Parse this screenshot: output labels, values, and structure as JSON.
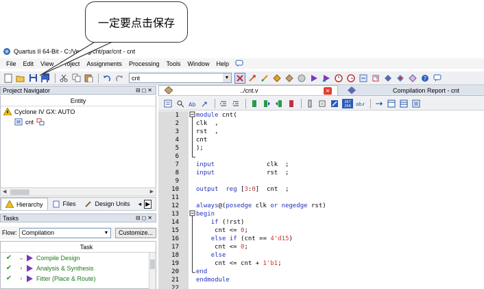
{
  "callout": {
    "text": "一定要点击保存"
  },
  "window": {
    "title": "Quartus II 64-Bit - C:/Verilog/cnt/par/cnt - cnt"
  },
  "menu": [
    "File",
    "Edit",
    "View",
    "Project",
    "Assignments",
    "Processing",
    "Tools",
    "Window",
    "Help"
  ],
  "toolbar": {
    "entity_combo": "cnt"
  },
  "project_navigator": {
    "title": "Project Navigator",
    "column": "Entity",
    "device": "Cyclone IV GX: AUTO",
    "top_entity": "cnt",
    "tabs": [
      "Hierarchy",
      "Files",
      "Design Units"
    ]
  },
  "tasks": {
    "title": "Tasks",
    "flow_label": "Flow:",
    "flow_value": "Compilation",
    "customize_label": "Customize...",
    "column": "Task",
    "rows": [
      {
        "label": "Compile Design",
        "expand": "⌄"
      },
      {
        "label": "Analysis & Synthesis",
        "expand": "›"
      },
      {
        "label": "Fitter (Place & Route)",
        "expand": "›"
      }
    ]
  },
  "editor": {
    "tab_file": "../cnt.v",
    "tab_report": "Compilation Report - cnt",
    "line_numbers": [
      "1",
      "2",
      "3",
      "4",
      "5",
      "6",
      "7",
      "8",
      "9",
      "10",
      "11",
      "12",
      "13",
      "14",
      "15",
      "16",
      "17",
      "18",
      "19",
      "20",
      "21",
      "22"
    ]
  },
  "colors": {
    "keyword": "#2030c0",
    "number": "#d03030",
    "task_text": "#1a7a1a"
  }
}
